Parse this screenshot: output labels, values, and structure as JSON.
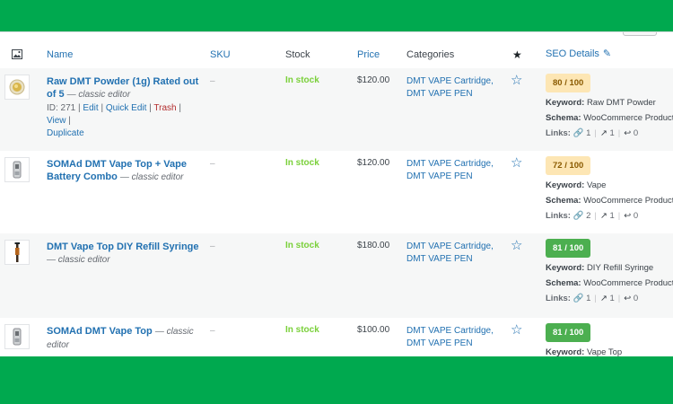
{
  "columns": {
    "name": "Name",
    "sku": "SKU",
    "stock": "Stock",
    "price": "Price",
    "categories": "Categories",
    "featured_icon": "star-icon",
    "seo_details": "SEO Details"
  },
  "labels": {
    "keyword": "Keyword:",
    "schema": "Schema:",
    "links": "Links:",
    "sep": "|"
  },
  "products": [
    {
      "name": "Raw DMT Powder (1g) Rated out of 5",
      "editor": "— classic editor",
      "sku": "–",
      "stock": "In stock",
      "price": "$120.00",
      "cat1": "DMT VAPE Cartridge,",
      "cat2": "DMT VAPE PEN",
      "score": "80 / 100",
      "keyword": "Raw DMT Powder",
      "schema": "WooCommerce Product",
      "links_internal": "1",
      "links_external": "1",
      "links_incoming": "0",
      "actions": {
        "id": "ID: 271",
        "edit": "Edit",
        "quick_edit": "Quick Edit",
        "trash": "Trash",
        "view": "View",
        "duplicate": "Duplicate"
      }
    },
    {
      "name": "SOMAd DMT Vape Top + Vape Battery Combo",
      "editor": "— classic editor",
      "sku": "–",
      "stock": "In stock",
      "price": "$120.00",
      "cat1": "DMT VAPE Cartridge,",
      "cat2": "DMT VAPE PEN",
      "score": "72 / 100",
      "keyword": "Vape",
      "schema": "WooCommerce Product",
      "links_internal": "2",
      "links_external": "1",
      "links_incoming": "0"
    },
    {
      "name": "DMT Vape Top DIY Refill Syringe",
      "editor": "— classic editor",
      "sku": "–",
      "stock": "In stock",
      "price": "$180.00",
      "cat1": "DMT VAPE Cartridge,",
      "cat2": "DMT VAPE PEN",
      "score": "81 / 100",
      "keyword": "DIY Refill Syringe",
      "schema": "WooCommerce Product",
      "links_internal": "1",
      "links_external": "1",
      "links_incoming": "0"
    },
    {
      "name": "SOMAd DMT Vape Top",
      "editor": "— classic editor",
      "sku": "–",
      "stock": "In stock",
      "price": "$100.00",
      "cat1": "DMT VAPE Cartridge,",
      "cat2": "DMT VAPE PEN",
      "score": "81 / 100",
      "keyword": "Vape Top"
    }
  ],
  "colors": {
    "brand_green": "#00a94f",
    "link_blue": "#2271b1",
    "in_stock_green": "#7ad03a",
    "score_warn_bg": "#fde6b4",
    "score_good_bg": "#4caf50",
    "trash_red": "#b32d2e"
  }
}
